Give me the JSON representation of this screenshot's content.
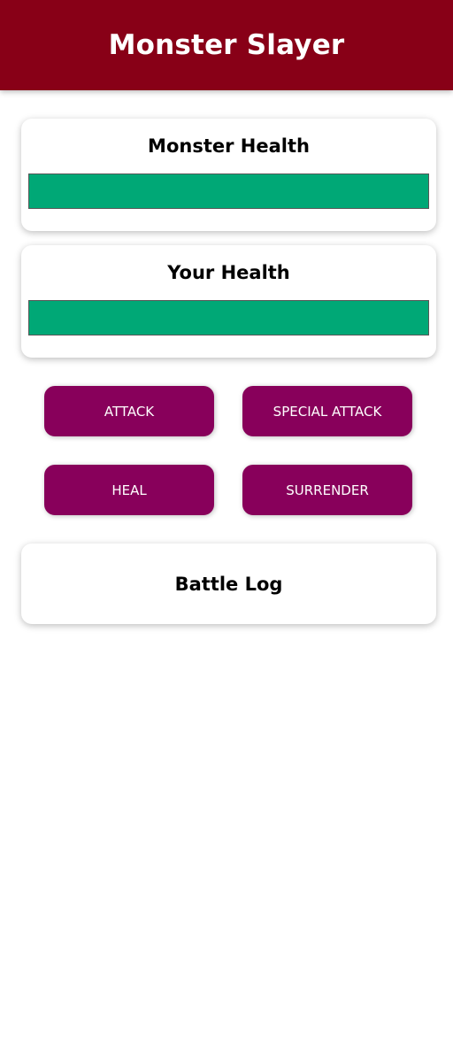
{
  "header": {
    "title": "Monster Slayer",
    "background_color": "#880017"
  },
  "monster": {
    "heading": "Monster Health",
    "health_percent": 100,
    "bar_color": "#00a876"
  },
  "player": {
    "heading": "Your Health",
    "health_percent": 100,
    "bar_color": "#00a876"
  },
  "controls": {
    "attack_label": "ATTACK",
    "special_attack_label": "SPECIAL ATTACK",
    "heal_label": "HEAL",
    "surrender_label": "SURRENDER",
    "button_color": "#88005b"
  },
  "battle_log": {
    "heading": "Battle Log"
  }
}
